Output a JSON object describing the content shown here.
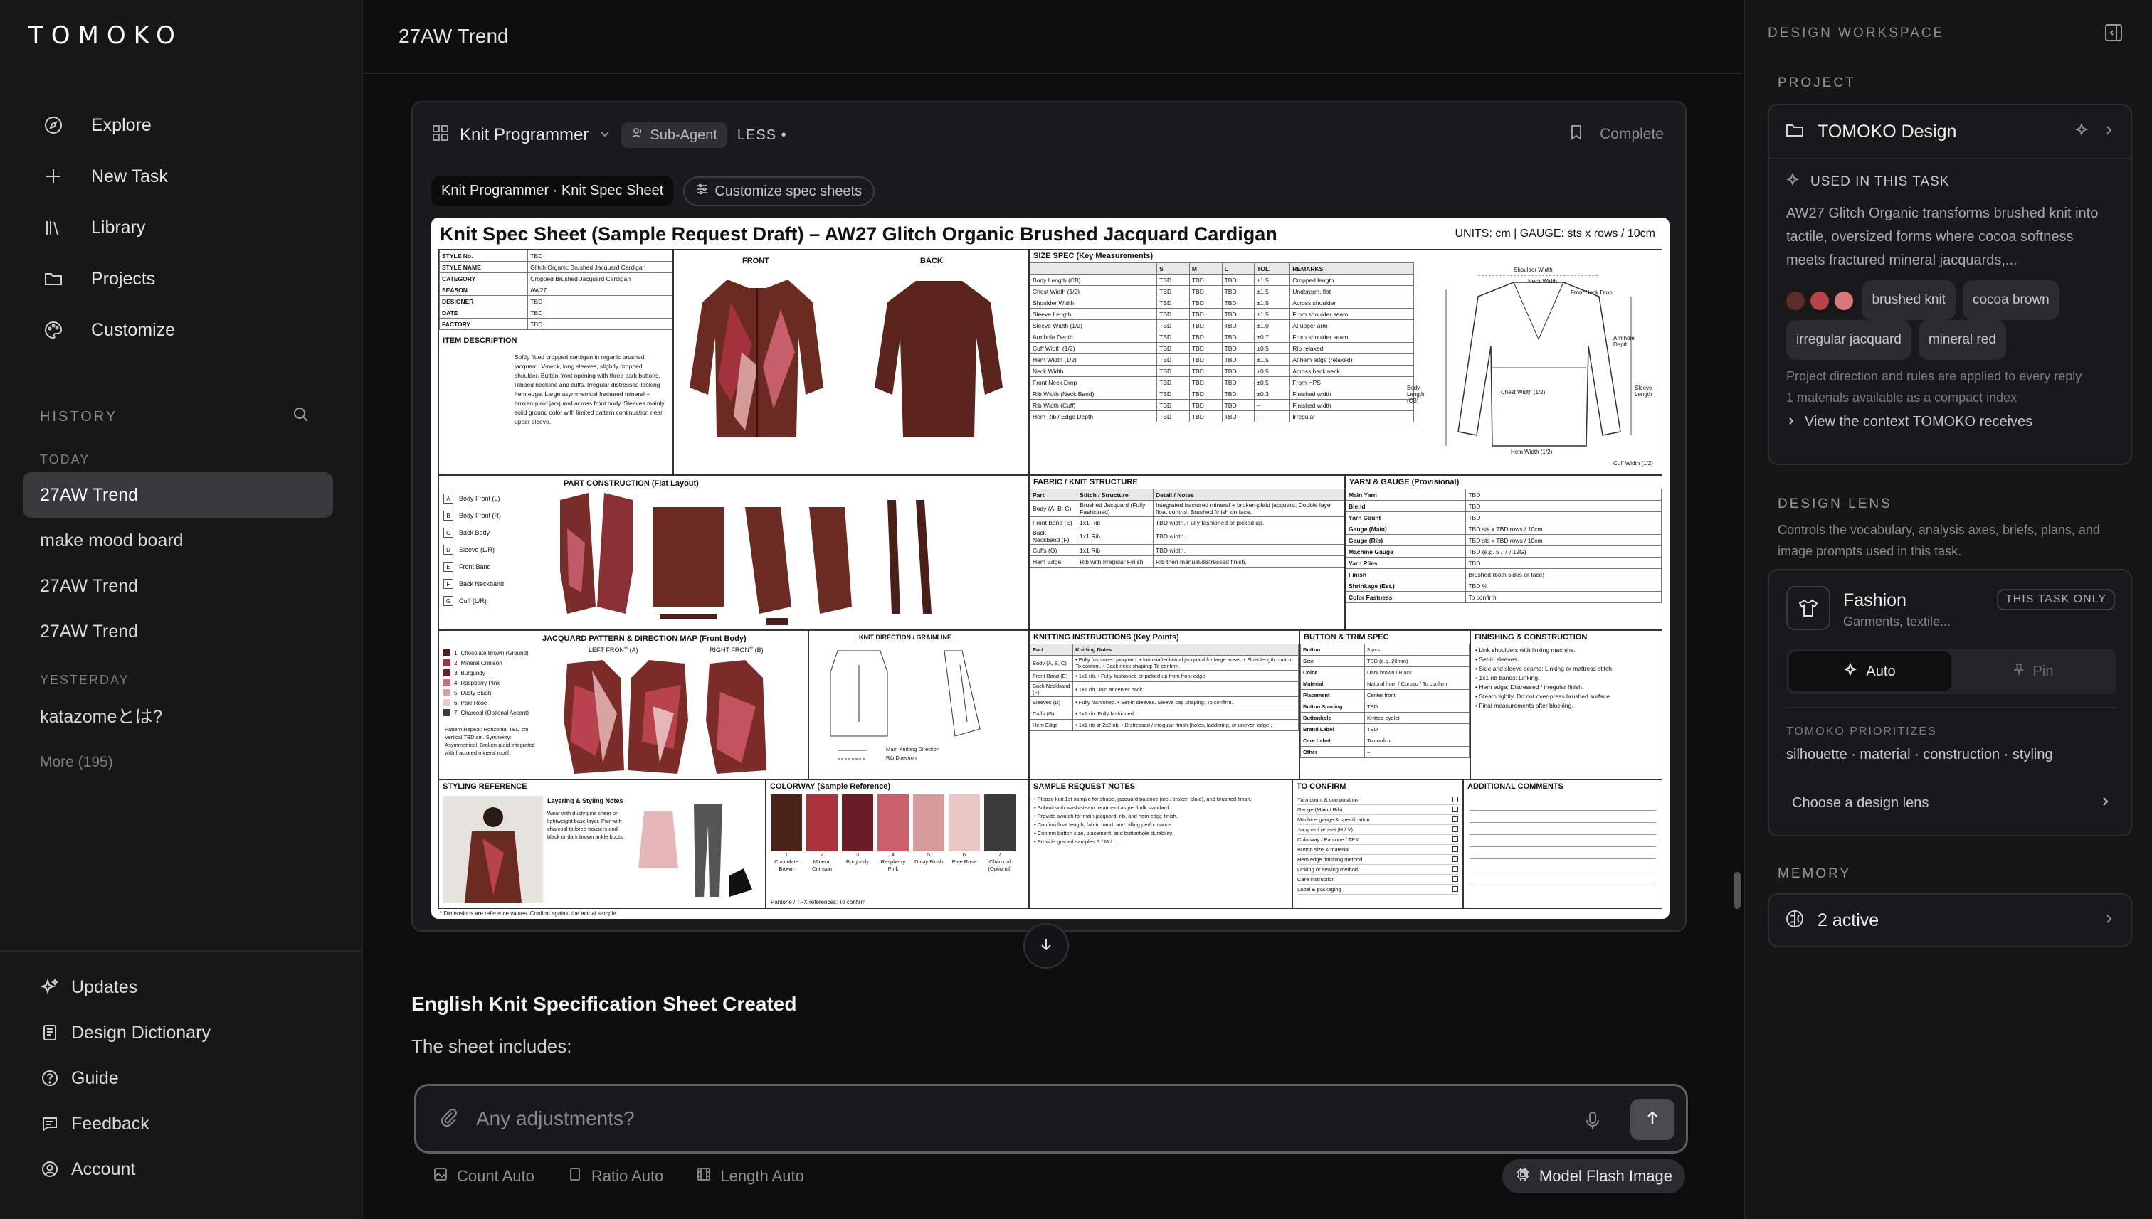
{
  "app": {
    "logo": "TOMOKO"
  },
  "nav": [
    {
      "label": "Explore",
      "icon": "compass-icon"
    },
    {
      "label": "New Task",
      "icon": "plus-icon"
    },
    {
      "label": "Library",
      "icon": "library-icon"
    },
    {
      "label": "Projects",
      "icon": "folder-icon"
    },
    {
      "label": "Customize",
      "icon": "palette-icon"
    }
  ],
  "history": {
    "title": "HISTORY",
    "today": "TODAY",
    "yesterday": "YESTERDAY",
    "items_today": [
      "27AW Trend",
      "make mood board",
      "27AW Trend",
      "27AW Trend"
    ],
    "items_yesterday": [
      "katazomeとは?"
    ],
    "more": "More (195)"
  },
  "bottom_nav": [
    {
      "label": "Updates",
      "icon": "sparkle-icon"
    },
    {
      "label": "Design Dictionary",
      "icon": "book-icon"
    },
    {
      "label": "Guide",
      "icon": "help-icon"
    },
    {
      "label": "Feedback",
      "icon": "chat-icon"
    },
    {
      "label": "Account",
      "icon": "user-icon"
    }
  ],
  "main": {
    "title": "27AW Trend",
    "agent": {
      "name": "Knit Programmer",
      "badge": "Sub-Agent",
      "less": "LESS •",
      "status": "Complete"
    },
    "tag_primary": "Knit Programmer · Knit Spec Sheet",
    "tag_secondary": "Customize spec sheets",
    "response_title": "English Knit Specification Sheet Created",
    "response_text": "The sheet includes:",
    "composer_placeholder": "Any adjustments?",
    "options": [
      "Count Auto",
      "Ratio Auto",
      "Length Auto"
    ],
    "model": "Model Flash Image"
  },
  "sheet": {
    "title": "Knit Spec Sheet (Sample Request Draft) – AW27 Glitch Organic Brushed Jacquard Cardigan",
    "units": "UNITS: cm  |  GAUGE: sts x rows / 10cm",
    "info_rows": [
      [
        "STYLE No.",
        "TBD"
      ],
      [
        "STYLE NAME",
        "Glitch Organic Brushed Jacquard Cardigan"
      ],
      [
        "CATEGORY",
        "Cropped Brushed Jacquard Cardigan"
      ],
      [
        "SEASON",
        "AW27"
      ],
      [
        "DESIGNER",
        "TBD"
      ],
      [
        "DATE",
        "TBD"
      ],
      [
        "FACTORY",
        "TBD"
      ]
    ],
    "item_desc_label": "ITEM DESCRIPTION",
    "item_desc": "Softly fitted cropped cardigan in organic brushed jacquard. V-neck, long sleeves, slightly dropped shoulder. Button-front opening with three dark buttons. Ribbed neckline and cuffs. Irregular distressed-looking hem edge. Large asymmetrical fractured mineral + broken-plaid jacquard across front body. Sleeves mainly solid ground color with limited pattern continuation near upper sleeve.",
    "front": "FRONT",
    "back": "BACK",
    "size_title": "SIZE SPEC (Key Measurements)",
    "size_cols": [
      "",
      "S",
      "M",
      "L",
      "TOL.",
      "REMARKS"
    ],
    "size_rows": [
      [
        "Body Length (CB)",
        "TBD",
        "TBD",
        "TBD",
        "±1.5",
        "Cropped length"
      ],
      [
        "Chest Width (1/2)",
        "TBD",
        "TBD",
        "TBD",
        "±1.5",
        "Underarm, flat"
      ],
      [
        "Shoulder Width",
        "TBD",
        "TBD",
        "TBD",
        "±1.5",
        "Across shoulder"
      ],
      [
        "Sleeve Length",
        "TBD",
        "TBD",
        "TBD",
        "±1.5",
        "From shoulder seam"
      ],
      [
        "Sleeve Width (1/2)",
        "TBD",
        "TBD",
        "TBD",
        "±1.0",
        "At upper arm"
      ],
      [
        "Armhole Depth",
        "TBD",
        "TBD",
        "TBD",
        "±0.7",
        "From shoulder seam"
      ],
      [
        "Cuff Width (1/2)",
        "TBD",
        "TBD",
        "TBD",
        "±0.5",
        "Rib relaxed"
      ],
      [
        "Hem Width (1/2)",
        "TBD",
        "TBD",
        "TBD",
        "±1.5",
        "At hem edge (relaxed)"
      ],
      [
        "Neck Width",
        "TBD",
        "TBD",
        "TBD",
        "±0.5",
        "Across back neck"
      ],
      [
        "Front Neck Drop",
        "TBD",
        "TBD",
        "TBD",
        "±0.5",
        "From HPS"
      ],
      [
        "Rib Width (Neck Band)",
        "TBD",
        "TBD",
        "TBD",
        "±0.3",
        "Finished width"
      ],
      [
        "Rib Width (Cuff)",
        "TBD",
        "TBD",
        "TBD",
        "–",
        "Finished width"
      ],
      [
        "Hem Rib / Edge Depth",
        "TBD",
        "TBD",
        "TBD",
        "–",
        "Irregular"
      ]
    ],
    "diagram_labels": [
      "Shoulder Width",
      "Neck Width",
      "Front Neck Drop",
      "Armhole Depth",
      "Body Length (CB)",
      "Chest Width (1/2)",
      "Sleeve Length",
      "Hem Width (1/2)",
      "Cuff Width (1/2)"
    ],
    "part_title": "PART CONSTRUCTION (Flat Layout)",
    "parts": [
      [
        "A",
        "Body Front (L)"
      ],
      [
        "B",
        "Body Front (R)"
      ],
      [
        "C",
        "Back Body"
      ],
      [
        "D",
        "Sleeve (L/R)"
      ],
      [
        "E",
        "Front Band"
      ],
      [
        "F",
        "Back Neckband"
      ],
      [
        "G",
        "Cuff (L/R)"
      ]
    ],
    "fabric_title": "FABRIC / KNIT STRUCTURE",
    "fabric_rows": [
      [
        "Part",
        "Stitch / Structure",
        "Detail / Notes"
      ],
      [
        "Body (A, B, C)",
        "Brushed Jacquard (Fully Fashioned)",
        "Integrated fractured mineral + broken-plaid jacquard. Double layer float control. Brushed finish on face."
      ],
      [
        "Front Band (E)",
        "1x1 Rib",
        "TBD width. Fully fashioned or picked up."
      ],
      [
        "Back Neckband (F)",
        "1x1 Rib",
        "TBD width."
      ],
      [
        "Cuffs (G)",
        "1x1 Rib",
        "TBD width."
      ],
      [
        "Hem Edge",
        "Rib with Irregular Finish",
        "Rib then manual/distressed finish."
      ]
    ],
    "yarn_title": "YARN & GAUGE (Provisional)",
    "yarn_rows": [
      [
        "Main Yarn",
        "TBD"
      ],
      [
        "Blend",
        "TBD"
      ],
      [
        "Yarn Count",
        "TBD"
      ],
      [
        "Gauge (Main)",
        "TBD sts x TBD rows / 10cm"
      ],
      [
        "Gauge (Rib)",
        "TBD sts x TBD rows / 10cm"
      ],
      [
        "Machine Gauge",
        "TBD (e.g. 5 / 7 / 12G)"
      ],
      [
        "Yarn Plies",
        "TBD"
      ],
      [
        "Finish",
        "Brushed (both sides or face)"
      ],
      [
        "Shrinkage (Est.)",
        "TBD %"
      ],
      [
        "Color Fastness",
        "To confirm"
      ]
    ],
    "jacquard_title": "JACQUARD PATTERN & DIRECTION MAP (Front Body)",
    "jacquard_colors": [
      [
        "1",
        "Chocolate Brown (Ground)",
        "#4a2218"
      ],
      [
        "2",
        "Mineral Crimson",
        "#a3323c"
      ],
      [
        "3",
        "Burgundy",
        "#6b1e28"
      ],
      [
        "4",
        "Raspberry Pink",
        "#d2707a"
      ],
      [
        "5",
        "Dusty Blush",
        "#d9a3a3"
      ],
      [
        "6",
        "Pale Rose",
        "#ecc9c6"
      ],
      [
        "7",
        "Charcoal (Optional Accent)",
        "#3a3a3a"
      ]
    ],
    "left_front": "LEFT FRONT (A)",
    "right_front": "RIGHT FRONT (B)",
    "knit_dir": "KNIT DIRECTION / GRAINLINE",
    "knit_dir_legend": [
      "Main Knitting Direction",
      "Rib Direction"
    ],
    "pattern_repeat": "Pattern Repeat: Horizontal TBD cm, Vertical TBD cm. Symmetry: Asymmetrical. Broken-plaid integrated with fractured mineral motif.",
    "knitting_title": "KNITTING INSTRUCTIONS (Key Points)",
    "knitting_rows": [
      [
        "Part",
        "Knitting Notes"
      ],
      [
        "Body (A, B, C)",
        "• Fully fashioned jacquard. • Intarsia/technical jacquard for large areas. • Float length control: To confirm. • Back neck shaping: To confirm."
      ],
      [
        "Front Band (E)",
        "• 1x1 rib. • Fully fashioned or picked up from front edge."
      ],
      [
        "Back Neckband (F)",
        "• 1x1 rib. Join at center back."
      ],
      [
        "Sleeves (D)",
        "• Fully fashioned. • Set-in sleeves. Sleeve cap shaping: To confirm."
      ],
      [
        "Cuffs (G)",
        "• 1x1 rib. Fully fashioned."
      ],
      [
        "Hem Edge",
        "• 1x1 rib or 2x2 rib. • Distressed / irregular finish (holes, laddering, or uneven edge)."
      ]
    ],
    "button_title": "BUTTON & TRIM SPEC",
    "button_rows": [
      [
        "Button",
        "3 pcs"
      ],
      [
        "Size",
        "TBD (e.g. 28mm)"
      ],
      [
        "Color",
        "Dark brown / Black"
      ],
      [
        "Material",
        "Natural horn / Corozo / To confirm"
      ],
      [
        "Placement",
        "Center front"
      ],
      [
        "Button Spacing",
        "TBD"
      ],
      [
        "Buttonhole",
        "Knitted eyelet"
      ],
      [
        "Brand Label",
        "TBD"
      ],
      [
        "Care Label",
        "To confirm"
      ],
      [
        "Other",
        "–"
      ]
    ],
    "finishing_title": "FINISHING & CONSTRUCTION",
    "finishing_items": [
      "• Link shoulders with linking machine.",
      "• Set-in sleeves.",
      "• Side and sleeve seams: Linking or mattress stitch.",
      "• 1x1 rib bands: Linking.",
      "• Hem edge: Distressed / irregular finish.",
      "• Steam lightly. Do not over-press brushed surface.",
      "• Final measurements after blocking."
    ],
    "styling_title": "STYLING REFERENCE",
    "styling_notes_title": "Layering & Styling Notes",
    "styling_notes": "Wear with dusty pink sheer or lightweight base layer. Pair with charcoal tailored trousers and black or dark brown ankle boots.",
    "colorway_title": "COLORWAY (Sample Reference)",
    "colorway": [
      [
        "1",
        "Chocolate Brown",
        "#4b2419"
      ],
      [
        "2",
        "Mineral Crimson",
        "#a9333d"
      ],
      [
        "3",
        "Burgundy",
        "#6a1d27"
      ],
      [
        "4",
        "Raspberry Pink",
        "#c9606c"
      ],
      [
        "5",
        "Dusty Blush",
        "#d89b9c"
      ],
      [
        "6",
        "Pale Rose",
        "#eac7c4"
      ],
      [
        "7",
        "Charcoal (Optional)",
        "#3b3b3b"
      ]
    ],
    "pantone": "Pantone / TPX references: To confirm",
    "sample_title": "SAMPLE REQUEST NOTES",
    "sample_items": [
      "• Please knit 1st sample for shape, jacquard balance (incl. broken-plaid), and brushed finish.",
      "• Submit with wash/steam treatment as per bulk standard.",
      "• Provide swatch for main jacquard, rib, and hem edge finish.",
      "• Confirm float length, fabric hand, and pilling performance.",
      "• Confirm button size, placement, and buttonhole durability.",
      "• Provide graded samples S / M / L."
    ],
    "confirm_title": "TO CONFIRM",
    "confirm_items": [
      "Yarn count & composition",
      "Gauge (Main / Rib)",
      "Machine gauge & specification",
      "Jacquard repeat (H / V)",
      "Colorway / Pantone / TPX",
      "Button size & material",
      "Hem edge finishing method",
      "Linking or sewing method",
      "Care instruction",
      "Label & packaging"
    ],
    "comments_title": "ADDITIONAL COMMENTS",
    "footnote": "* Dimensions are reference values. Confirm against the actual sample."
  },
  "right_panel": {
    "title": "DESIGN WORKSPACE",
    "project_label": "PROJECT",
    "project_name": "TOMOKO Design",
    "used_label": "USED IN THIS TASK",
    "used_text": "AW27 Glitch Organic transforms brushed knit into tactile, oversized forms where cocoa softness meets fractured mineral jacquards,...",
    "swatches": [
      "#5b2e27",
      "#b9434a",
      "#d9787c"
    ],
    "chips": [
      "brushed knit",
      "cocoa brown",
      "irregular jacquard",
      "mineral red"
    ],
    "note1": "Project direction and rules are applied to every reply",
    "note2": "1 materials available as a compact index",
    "context_link": "View the context TOMOKO receives",
    "lens_label": "DESIGN LENS",
    "lens_desc": "Controls the vocabulary, analysis axes, briefs, plans, and image prompts used in this task.",
    "lens_name": "Fashion",
    "lens_sub": "Garments, textile...",
    "lens_badge": "THIS TASK ONLY",
    "auto": "Auto",
    "pin": "Pin",
    "priorities_label": "TOMOKO PRIORITIZES",
    "priorities": "silhouette · material · construction · styling",
    "choose_lens": "Choose a design lens",
    "memory_label": "MEMORY",
    "memory_value": "2 active"
  }
}
